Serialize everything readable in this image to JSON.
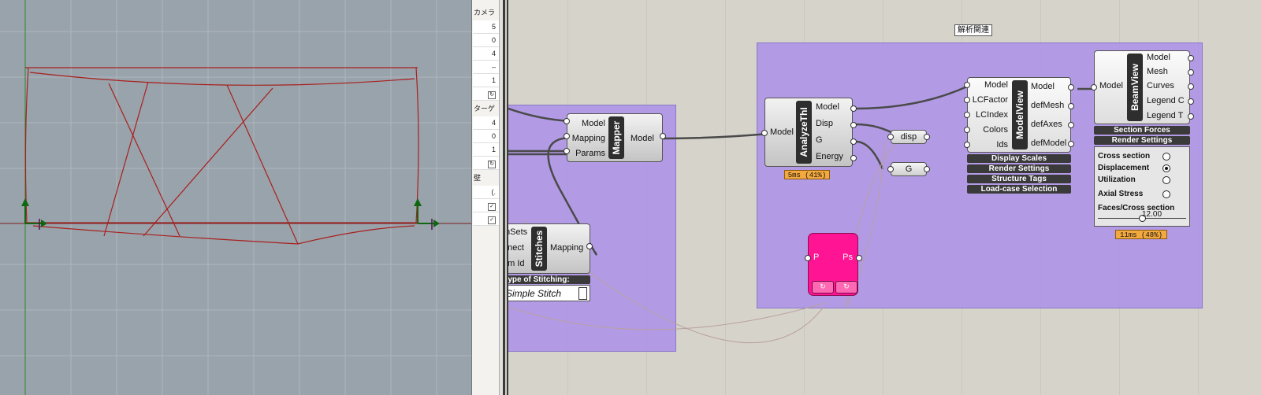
{
  "param_strip": {
    "items": [
      "カメラ",
      "5",
      "0",
      "4",
      "–",
      "1",
      "ターゲ",
      "4",
      "0",
      "1",
      "壁",
      "(."
    ]
  },
  "group_label": "解析関連",
  "mapper": {
    "name": "Mapper",
    "inputs": [
      "Model",
      "Mapping",
      "Params"
    ],
    "outputs": [
      "Model"
    ]
  },
  "stitches": {
    "name": "Stitches",
    "inputs": [
      "mSets",
      "nnect",
      "am Id"
    ],
    "outputs": [
      "Mapping"
    ],
    "menu_label": "Type of Stitching:",
    "value": "Simple Stitch"
  },
  "analyze": {
    "name": "AnalyzeThI",
    "inputs": [
      "Model"
    ],
    "outputs": [
      "Model",
      "Disp",
      "G",
      "Energy"
    ],
    "timing": "5ms (41%)"
  },
  "relays": {
    "disp": "disp",
    "g": "G"
  },
  "modelview": {
    "name": "ModelView",
    "inputs": [
      "Model",
      "LCFactor",
      "LCIndex",
      "Colors",
      "Ids"
    ],
    "outputs": [
      "Model",
      "defMesh",
      "defAxes",
      "defModel"
    ],
    "menus": [
      "Display Scales",
      "Render Settings",
      "Structure Tags",
      "Load-case Selection"
    ]
  },
  "beamview": {
    "name": "BeamView",
    "inputs": [
      "Model"
    ],
    "outputs": [
      "Model",
      "Mesh",
      "Curves",
      "Legend C",
      "Legend T"
    ],
    "menus": [
      "Section Forces",
      "Render Settings"
    ],
    "options": [
      "Cross section",
      "Displacement",
      "Utilization",
      "Axial Stress"
    ],
    "selected_option": "Displacement",
    "slider_label": "Faces/Cross section",
    "slider_value": "12.00",
    "slider_fraction": 0.5,
    "timing": "11ms (48%)"
  },
  "pink": {
    "input": "P",
    "output": "Ps"
  },
  "colors": {
    "group": "#a88ceb",
    "pink": "#ff1493",
    "timing": "#f4a93f",
    "structure": "#a8201e"
  }
}
